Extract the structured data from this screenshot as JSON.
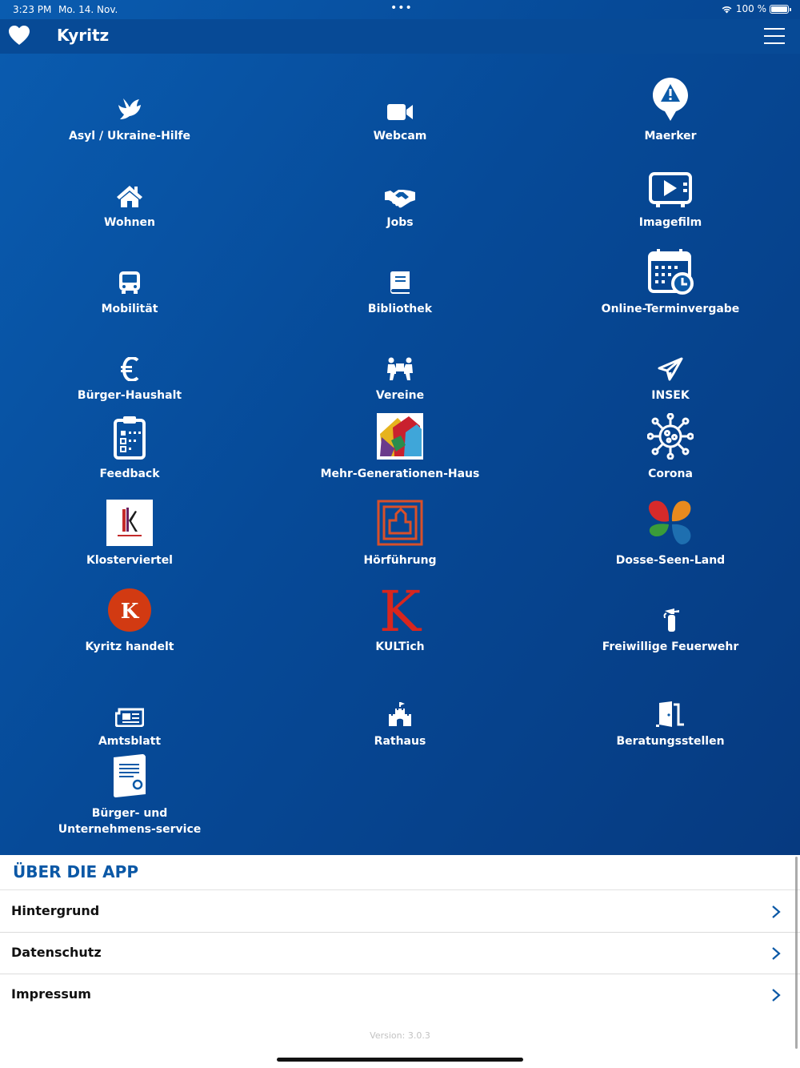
{
  "status_bar": {
    "time": "3:23 PM",
    "date": "Mo. 14. Nov.",
    "multitask": "•••",
    "battery": "100 %"
  },
  "nav": {
    "title": "Kyritz",
    "heart_icon": "heart-icon",
    "menu_icon": "hamburger-menu-icon"
  },
  "tiles": [
    {
      "label": "Asyl / Ukraine-Hilfe",
      "icon": "dove-icon"
    },
    {
      "label": "Webcam",
      "icon": "video-camera-icon"
    },
    {
      "label": "Maerker",
      "icon": "map-pin-warning-icon"
    },
    {
      "label": "Wohnen",
      "icon": "home-icon"
    },
    {
      "label": "Jobs",
      "icon": "handshake-icon"
    },
    {
      "label": "Imagefilm",
      "icon": "tv-play-icon"
    },
    {
      "label": "Mobilität",
      "icon": "bus-icon"
    },
    {
      "label": "Bibliothek",
      "icon": "book-icon"
    },
    {
      "label": "Online-Terminvergabe",
      "icon": "calendar-clock-icon"
    },
    {
      "label": "Bürger-Haushalt",
      "icon": "euro-icon"
    },
    {
      "label": "Vereine",
      "icon": "people-carry-icon"
    },
    {
      "label": "INSEK",
      "icon": "paper-plane-icon"
    },
    {
      "label": "Feedback",
      "icon": "clipboard-rating-icon"
    },
    {
      "label": "Mehr-Generationen-Haus",
      "icon": "mehrgenerationenhaus-logo"
    },
    {
      "label": "Corona",
      "icon": "virus-icon"
    },
    {
      "label": "Klosterviertel",
      "icon": "klosterviertel-logo"
    },
    {
      "label": "Hörführung",
      "icon": "hoerfuehrung-logo"
    },
    {
      "label": "Dosse-Seen-Land",
      "icon": "dosse-seen-land-logo"
    },
    {
      "label": "Kyritz handelt",
      "icon": "kyritz-handelt-logo"
    },
    {
      "label": "KULTich",
      "icon": "kultich-logo"
    },
    {
      "label": "Freiwillige Feuerwehr",
      "icon": "fire-extinguisher-icon"
    },
    {
      "label": "Amtsblatt",
      "icon": "newspaper-icon"
    },
    {
      "label": "Rathaus",
      "icon": "town-hall-icon"
    },
    {
      "label": "Beratungsstellen",
      "icon": "door-open-icon"
    },
    {
      "label": "Bürger- und Unternehmens-service",
      "icon": "certificate-document-icon"
    }
  ],
  "about": {
    "title": "ÜBER DIE APP",
    "items": [
      {
        "label": "Hintergrund"
      },
      {
        "label": "Datenschutz"
      },
      {
        "label": "Impressum"
      }
    ]
  },
  "version": "Version: 3.0.3",
  "colors": {
    "primary": "#074a96",
    "accent_title": "#0b58a6",
    "kyritz_handelt": "#d23a12",
    "hoerfuehrung": "#d8502a",
    "kultich": "#d8261e"
  }
}
